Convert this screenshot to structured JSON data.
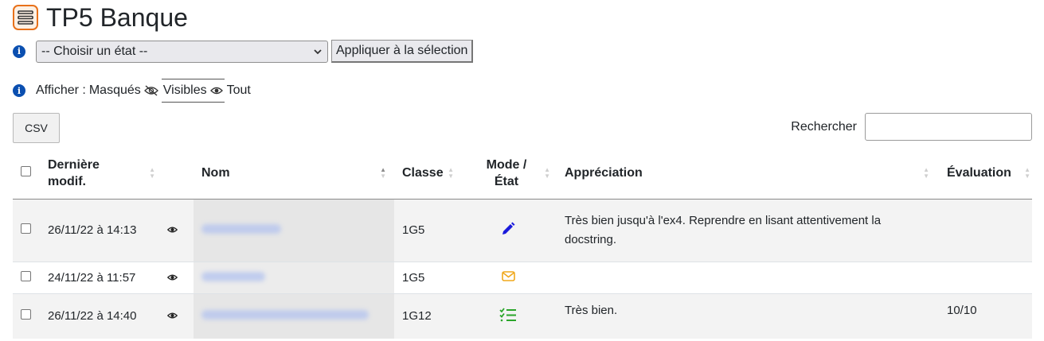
{
  "header": {
    "title": "TP5 Banque",
    "logo_icon": "list-icon"
  },
  "toolbar": {
    "select_value": "-- Choisir un état --",
    "apply_label": "Appliquer à la sélection"
  },
  "filters": {
    "label": "Afficher :",
    "masked": "Masqués",
    "visible": "Visibles",
    "all": "Tout",
    "active": "Visibles"
  },
  "csv_label": "CSV",
  "search": {
    "label": "Rechercher",
    "value": ""
  },
  "table": {
    "headers": {
      "last_modified": "Dernière modif.",
      "name": "Nom",
      "class": "Classe",
      "mode_state": "Mode / État",
      "appreciation": "Appréciation",
      "evaluation": "Évaluation"
    },
    "rows": [
      {
        "date": "26/11/22 à 14:13",
        "class": "1G5",
        "mode_icon": "pencil-icon",
        "mode_color": "#1a1adb",
        "appreciation_line1": "Très bien jusqu'à l'ex4. Reprendre en lisant attentivement la",
        "appreciation_line2": "docstring.",
        "evaluation": ""
      },
      {
        "date": "24/11/22 à 11:57",
        "class": "1G5",
        "mode_icon": "envelope-icon",
        "mode_color": "#f0a81c",
        "appreciation_line1": "",
        "appreciation_line2": "",
        "evaluation": ""
      },
      {
        "date": "26/11/22 à 14:40",
        "class": "1G12",
        "mode_icon": "checklist-icon",
        "mode_color": "#2aa52a",
        "appreciation_line1": "Très bien.",
        "appreciation_line2": "",
        "evaluation": "10/10"
      }
    ]
  },
  "colors": {
    "accent": "#e8711a",
    "info": "#0b4fb0"
  }
}
